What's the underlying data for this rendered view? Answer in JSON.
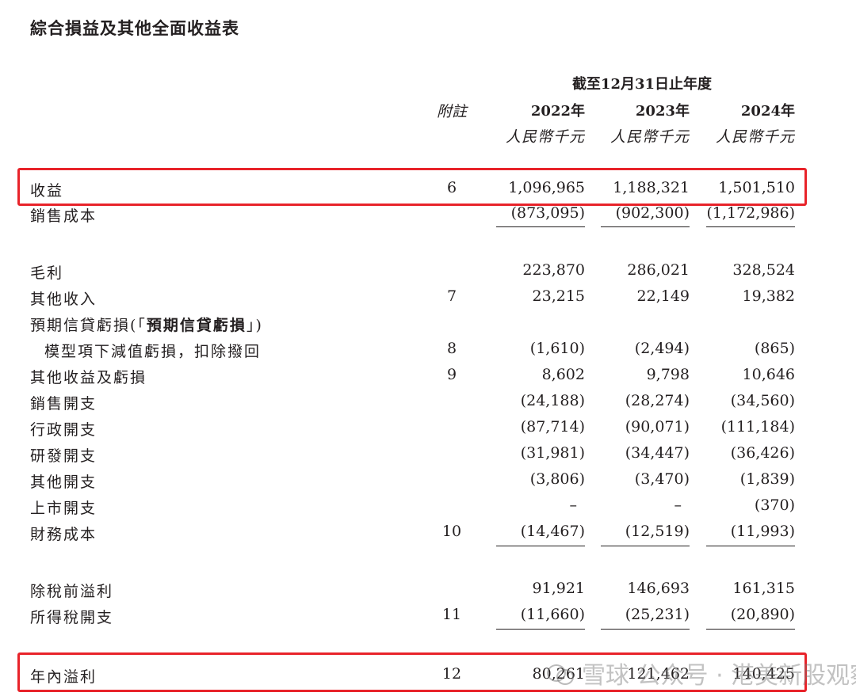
{
  "title": "綜合損益及其他全面收益表",
  "period_header": "截至12月31日止年度",
  "note_header": "附註",
  "years": [
    "2022年",
    "2023年",
    "2024年"
  ],
  "units": [
    "人民幣千元",
    "人民幣千元",
    "人民幣千元"
  ],
  "rows": [
    {
      "label": "收益",
      "note": "6",
      "values": [
        "1,096,965",
        "1,188,321",
        "1,501,510"
      ]
    },
    {
      "label": "銷售成本",
      "note": "",
      "values": [
        "(873,095)",
        "(902,300)",
        "(1,172,986)"
      ]
    },
    {
      "label": "毛利",
      "note": "",
      "values": [
        "223,870",
        "286,021",
        "328,524"
      ]
    },
    {
      "label": "其他收入",
      "note": "7",
      "values": [
        "23,215",
        "22,149",
        "19,382"
      ]
    },
    {
      "label_prefix": "預期信貸虧損(「",
      "label_bold": "預期信貸虧損",
      "label_suffix": "」)",
      "note": "",
      "values": [
        "",
        "",
        ""
      ]
    },
    {
      "label": "模型項下減值虧損，扣除撥回",
      "note": "8",
      "values": [
        "(1,610)",
        "(2,494)",
        "(865)"
      ]
    },
    {
      "label": "其他收益及虧損",
      "note": "9",
      "values": [
        "8,602",
        "9,798",
        "10,646"
      ]
    },
    {
      "label": "銷售開支",
      "note": "",
      "values": [
        "(24,188)",
        "(28,274)",
        "(34,560)"
      ]
    },
    {
      "label": "行政開支",
      "note": "",
      "values": [
        "(87,714)",
        "(90,071)",
        "(111,184)"
      ]
    },
    {
      "label": "研發開支",
      "note": "",
      "values": [
        "(31,981)",
        "(34,447)",
        "(36,426)"
      ]
    },
    {
      "label": "其他開支",
      "note": "",
      "values": [
        "(3,806)",
        "(3,470)",
        "(1,839)"
      ]
    },
    {
      "label": "上市開支",
      "note": "",
      "values": [
        "–",
        "–",
        "(370)"
      ]
    },
    {
      "label": "財務成本",
      "note": "10",
      "values": [
        "(14,467)",
        "(12,519)",
        "(11,993)"
      ]
    },
    {
      "label": "除稅前溢利",
      "note": "",
      "values": [
        "91,921",
        "146,693",
        "161,315"
      ]
    },
    {
      "label": "所得稅開支",
      "note": "11",
      "values": [
        "(11,660)",
        "(25,231)",
        "(20,890)"
      ]
    },
    {
      "label": "年內溢利",
      "note": "12",
      "values": [
        "80,261",
        "121,462",
        "140,425"
      ]
    }
  ],
  "watermark": "雪球  公众号 · 港美新股观察",
  "highlight_color": "#e8232a"
}
